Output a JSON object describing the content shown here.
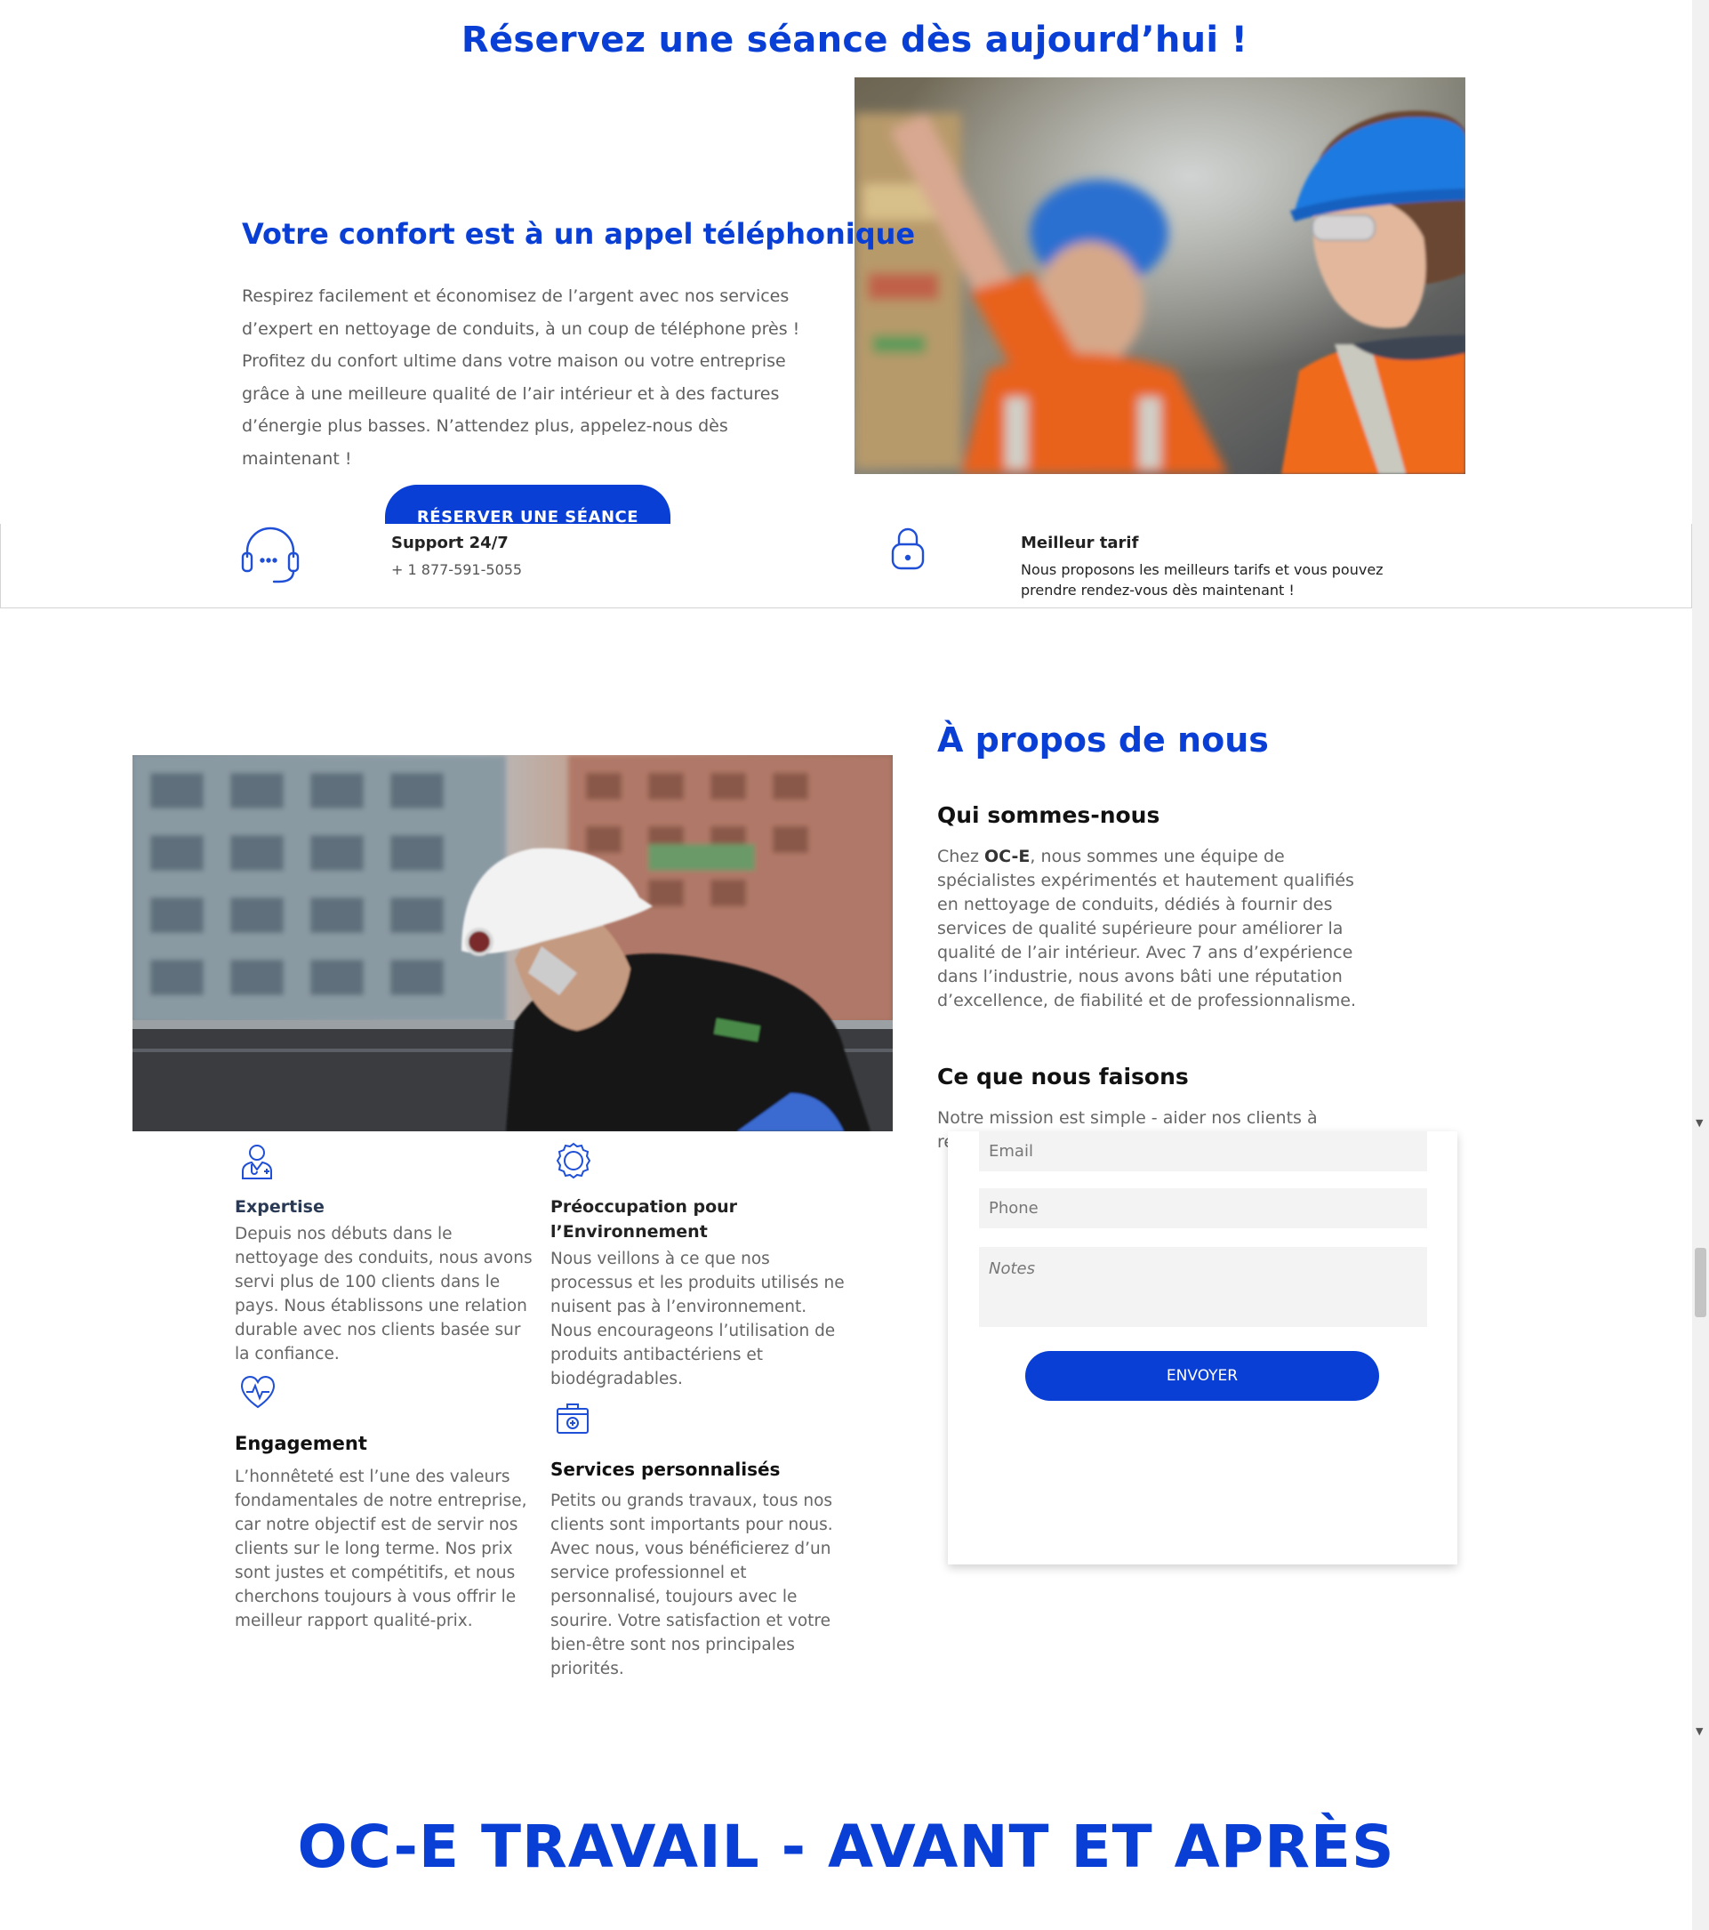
{
  "hero": {
    "title": "Réservez une séance dès aujourd’hui !",
    "subtitle": "Votre confort est à un appel téléphonique",
    "paragraph": "Respirez facilement et économisez de l’argent avec nos services d’expert en nettoyage de conduits, à un coup de téléphone près ! Profitez du confort ultime dans votre maison ou votre entreprise grâce à une meilleure qualité de l’air intérieur et à des factures d’énergie plus basses. N’attendez plus, appelez-nous dès maintenant !",
    "cta_label": "RÉSERVER UNE SÉANCE"
  },
  "info_bar": {
    "support": {
      "icon": "headset-icon",
      "title": "Support 24/7",
      "text": "+ 1 877-591-5055"
    },
    "price": {
      "icon": "lock-icon",
      "title": "Meilleur tarif",
      "text": "Nous proposons les meilleurs tarifs et vous pouvez prendre rendez-vous dès maintenant !"
    }
  },
  "about": {
    "title": "À propos de nous",
    "who_title": "Qui sommes-nous",
    "who_prefix": "Chez ",
    "who_brand": "OC-E",
    "who_text": ", nous sommes une équipe de spécialistes expérimentés et hautement qualifiés en nettoyage de conduits, dédiés à fournir des services de qualité supérieure pour améliorer la qualité de l’air intérieur. Avec 7 ans d’expérience dans l’industrie, nous avons bâti une réputation d’excellence, de fiabilité et de professionnalisme.",
    "what_title": "Ce que nous faisons",
    "what_text": "Notre mission est simple - aider nos clients à respirer"
  },
  "features": [
    {
      "icon": "doctor-icon",
      "title": "Expertise",
      "text": "Depuis nos débuts dans le nettoyage des conduits, nous avons servi plus de 100 clients dans le pays. Nous établissons une relation durable avec nos clients basée sur la confiance."
    },
    {
      "icon": "award-icon",
      "title": "Préoccupation pour l’Environnement",
      "text": "Nous veillons à ce que nos processus et les produits utilisés ne nuisent pas à l’environnement. Nous encourageons l’utilisation de produits antibactériens et biodégradables."
    },
    {
      "icon": "heart-pulse-icon",
      "title": "Engagement",
      "text": "L’honnêteté est l’une des valeurs fondamentales de notre entreprise, car notre objectif est de servir nos clients sur le long terme. Nos prix sont justes et compétitifs, et nous cherchons toujours à vous offrir le meilleur rapport qualité-prix."
    },
    {
      "icon": "first-aid-kit-icon",
      "title": "Services personnalisés",
      "text": "Petits ou grands travaux, tous nos clients sont importants pour nous. Avec nous, vous bénéficierez d’un service professionnel et personnalisé, toujours avec le sourire. Votre satisfaction et votre bien-être sont nos principales priorités."
    }
  ],
  "form": {
    "email_placeholder": "Email",
    "phone_placeholder": "Phone",
    "notes_placeholder": "Notes",
    "submit_label": "ENVOYER"
  },
  "work": {
    "title": "OC-E TRAVAIL - AVANT ET APRÈS"
  },
  "colors": {
    "brand_blue": "#0a3fd6",
    "text_gray": "#666666",
    "field_bg": "#f3f3f3"
  }
}
